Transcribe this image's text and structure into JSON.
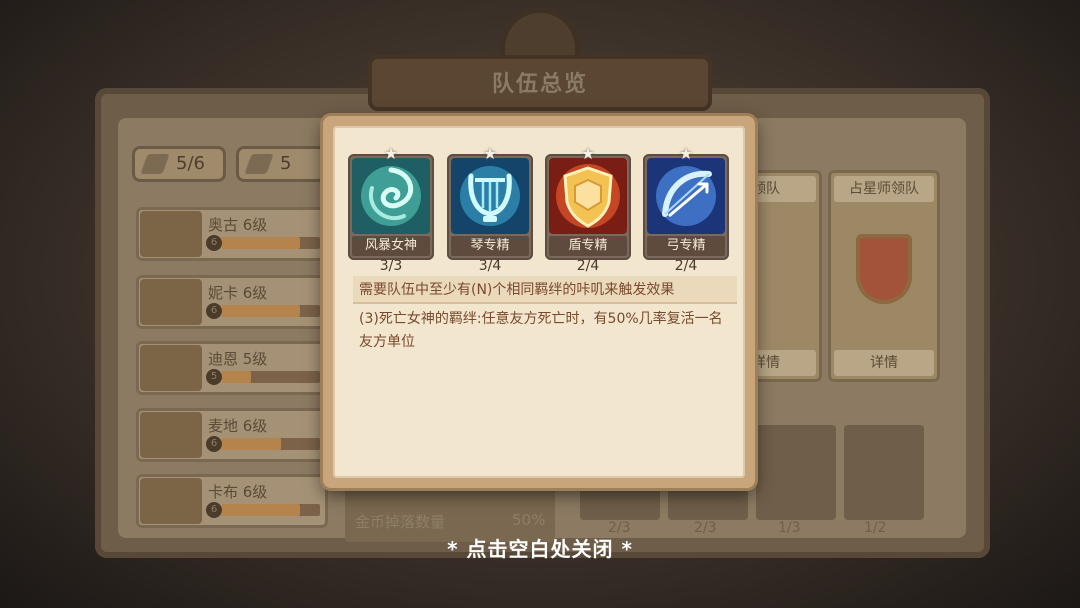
{
  "background": {
    "title": "队伍总览",
    "chips": [
      "5/6",
      "5"
    ],
    "heroes": [
      {
        "name": "奥古 6级",
        "level": "6",
        "fill": 0.8
      },
      {
        "name": "妮卡 6级",
        "level": "6",
        "fill": 0.8
      },
      {
        "name": "迪恩 5级",
        "level": "5",
        "fill": 0.3
      },
      {
        "name": "麦地 6级",
        "level": "6",
        "fill": 0.6
      },
      {
        "name": "卡布 6级",
        "level": "6",
        "fill": 0.8
      }
    ],
    "leaders": [
      {
        "title": "领队",
        "button": "详情"
      },
      {
        "title": "占星师领队",
        "button": "详情"
      }
    ],
    "stats": [
      {
        "label": "金币掉落数量",
        "value": "50%"
      }
    ],
    "fractions": [
      "2/3",
      "2/3",
      "1/3",
      "1/2"
    ]
  },
  "modal": {
    "bonds": [
      {
        "name": "风暴女神",
        "count": "3/3",
        "icon": "storm-swirl-icon",
        "color": "#3f9f97"
      },
      {
        "name": "琴专精",
        "count": "3/4",
        "icon": "lyre-icon",
        "color": "#2b7fa6"
      },
      {
        "name": "盾专精",
        "count": "2/4",
        "icon": "shield-icon",
        "color": "#c44624"
      },
      {
        "name": "弓专精",
        "count": "2/4",
        "icon": "bow-icon",
        "color": "#3d6fc2"
      }
    ],
    "description_header": "需要队伍中至少有(N)个相同羁绊的咔叽来触发效果",
    "description_body": "(3)死亡女神的羁绊:任意友方死亡时，有50%几率复活一名友方单位"
  },
  "close_hint": "* 点击空白处关闭 *"
}
